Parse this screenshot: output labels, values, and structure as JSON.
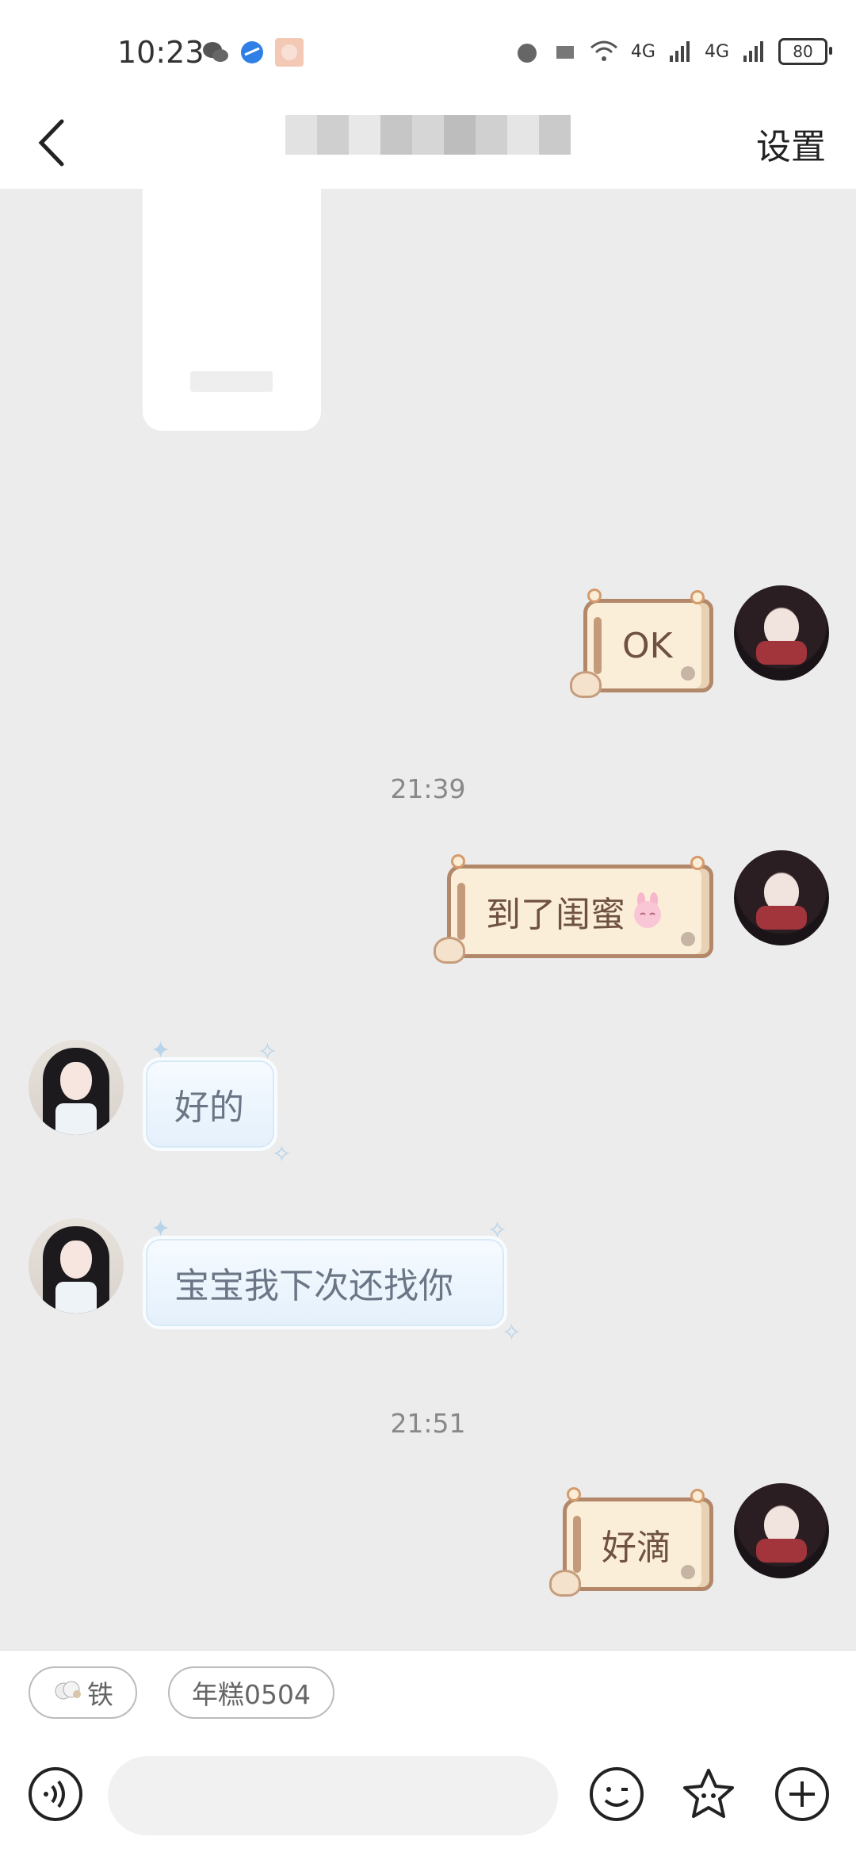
{
  "status_bar": {
    "time": "10:23",
    "icons": [
      "wechat-icon",
      "browser-icon",
      "app-avatar-icon"
    ],
    "network": [
      "4G",
      "4G"
    ],
    "battery": "80"
  },
  "nav": {
    "back_icon": "chevron-left-icon",
    "title": "",
    "settings_label": "设置"
  },
  "messages": [
    {
      "type": "card",
      "side": "peer"
    },
    {
      "type": "text",
      "side": "self",
      "text": "OK"
    },
    {
      "type": "time",
      "text": "21:39"
    },
    {
      "type": "text",
      "side": "self",
      "text": "到了闺蜜",
      "emoji": "bunny-emoji"
    },
    {
      "type": "text",
      "side": "peer",
      "text": "好的"
    },
    {
      "type": "text",
      "side": "peer",
      "text": "宝宝我下次还找你"
    },
    {
      "type": "time",
      "text": "21:51"
    },
    {
      "type": "text",
      "side": "self",
      "text": "好滴"
    }
  ],
  "quick_chips": [
    {
      "icon": "sheep-icon",
      "label": "铁"
    },
    {
      "label": "年糕0504"
    }
  ],
  "input_bar": {
    "voice_icon": "voice-icon",
    "emoji_icon": "smile-icon",
    "sticker_icon": "star-face-icon",
    "plus_icon": "plus-icon"
  },
  "colors": {
    "background": "#ececec",
    "self_bubble": "#fbeed8",
    "peer_bubble": "#e4f0fb"
  }
}
